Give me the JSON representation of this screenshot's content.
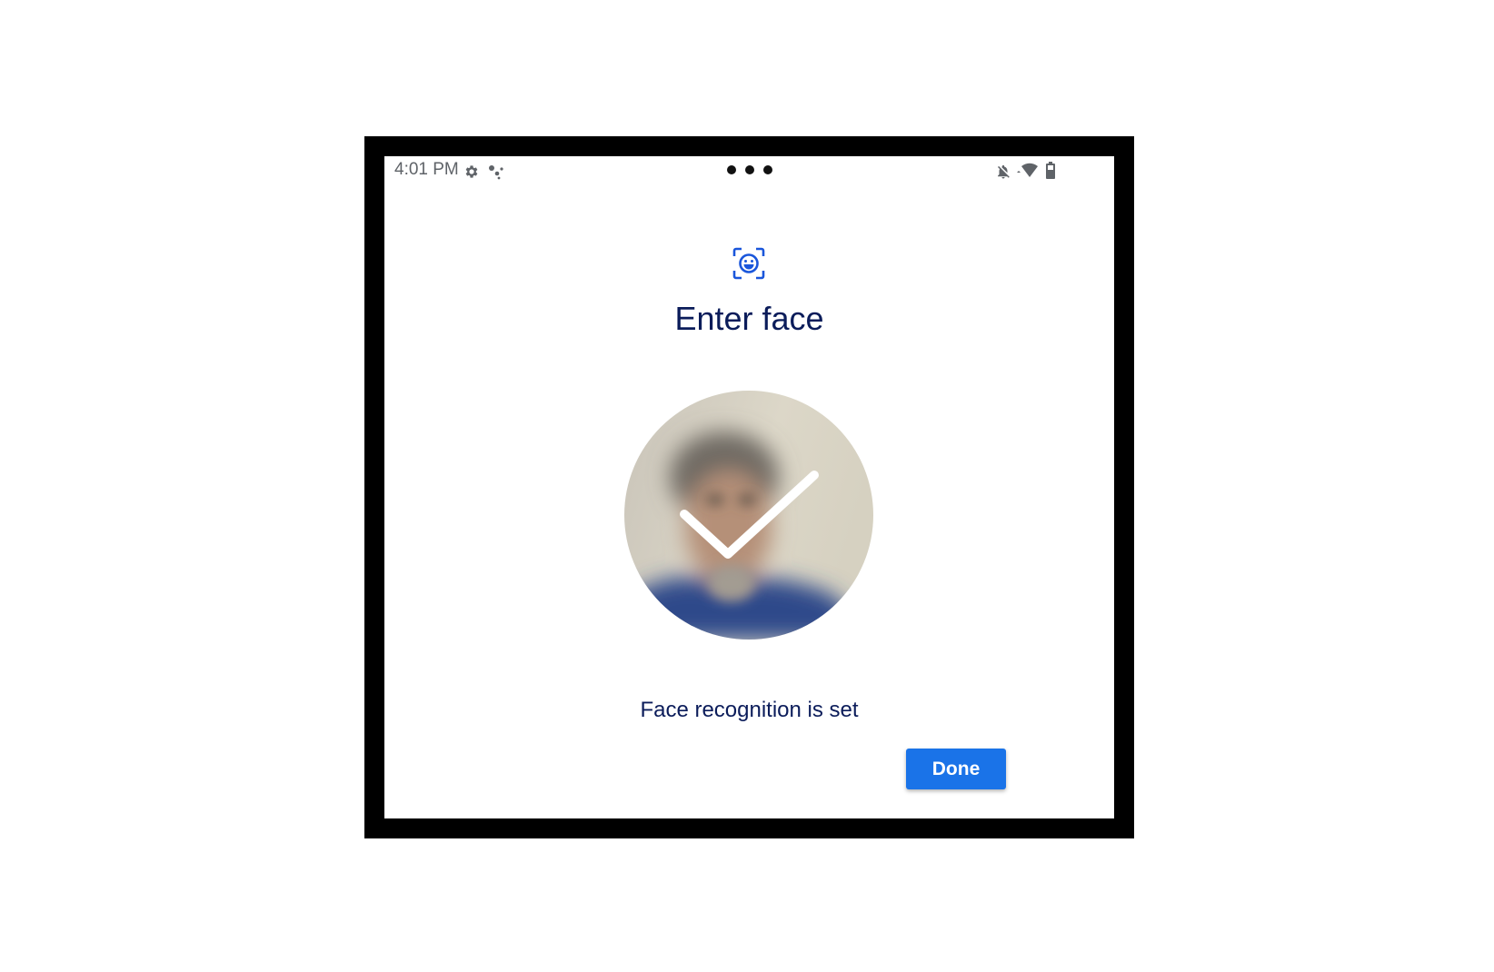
{
  "status_bar": {
    "time": "4:01 PM",
    "left_icons": [
      "gear-icon",
      "assistant-icon"
    ],
    "right_icons": [
      "notifications-off-icon",
      "wifi-icon",
      "battery-icon"
    ]
  },
  "header": {
    "icon": "face-id-icon",
    "title": "Enter face"
  },
  "face_preview": {
    "overlay_icon": "checkmark-icon"
  },
  "message": "Face recognition is set",
  "actions": {
    "done_label": "Done"
  },
  "colors": {
    "accent": "#1a73e8",
    "title_text": "#0b1c5a",
    "status_text": "#5f6368",
    "frame": "#000000"
  }
}
